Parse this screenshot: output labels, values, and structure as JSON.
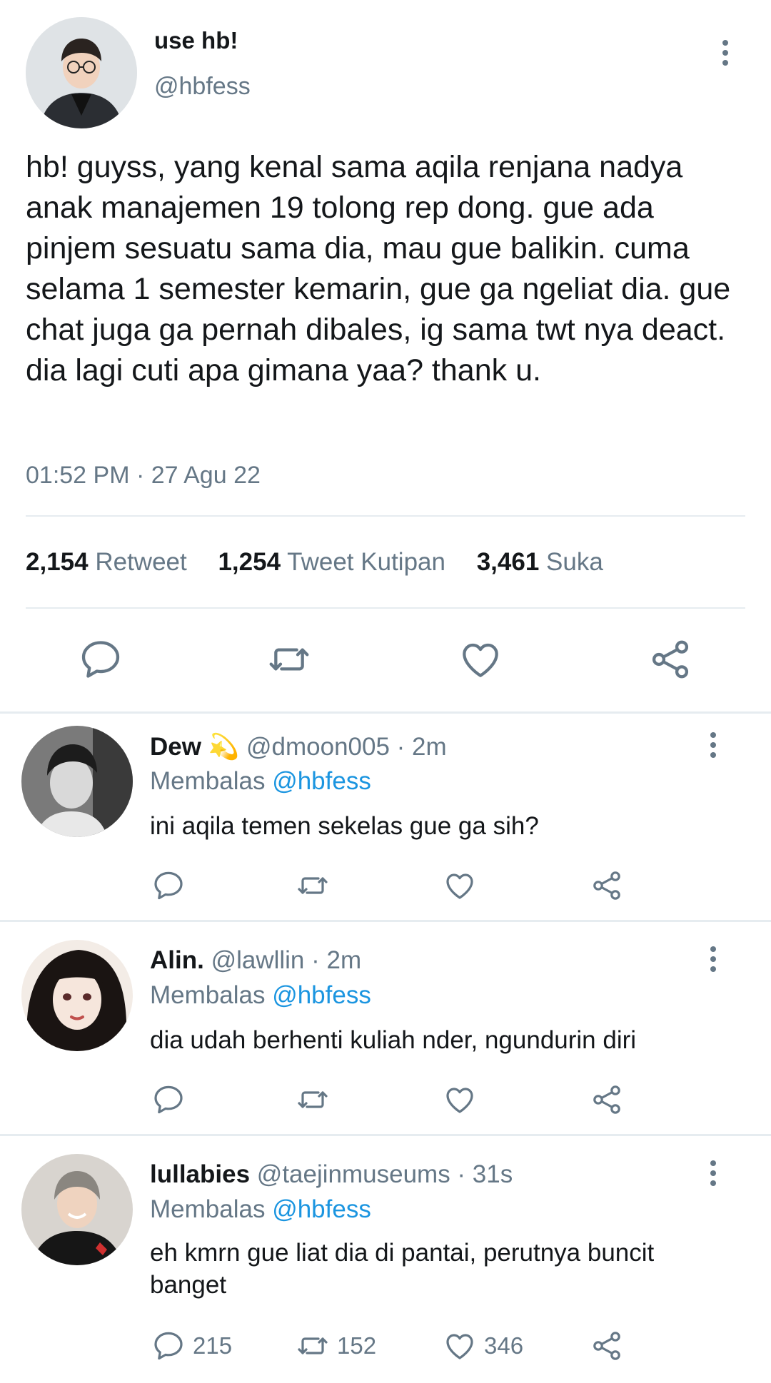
{
  "main_tweet": {
    "display_name": "use hb!",
    "handle": "@hbfess",
    "text": "hb! guyss, yang kenal sama aqila renjana nadya anak manajemen 19 tolong rep dong. gue ada pinjem sesuatu sama dia, mau gue balikin. cuma selama 1 semester kemarin, gue ga ngeliat dia. gue chat juga ga pernah dibales, ig sama twt nya deact. dia lagi cuti apa gimana yaa? thank u.",
    "timestamp": "01:52 PM · 27 Agu 22",
    "stats": {
      "retweets": "2,154",
      "retweets_label": "Retweet",
      "quotes": "1,254",
      "quotes_label": "Tweet Kutipan",
      "likes": "3,461",
      "likes_label": "Suka"
    }
  },
  "replies": [
    {
      "name": "Dew 💫",
      "meta": "@dmoon005 · 2m",
      "replying_prefix": "Membalas",
      "replying_to": "@hbfess",
      "text": "ini aqila temen sekelas gue ga sih?",
      "reply_count": "",
      "retweet_count": "",
      "like_count": ""
    },
    {
      "name": "Alin.",
      "meta": "@lawllin · 2m",
      "replying_prefix": "Membalas",
      "replying_to": "@hbfess",
      "text": "dia udah berhenti kuliah nder, ngundurin diri",
      "reply_count": "",
      "retweet_count": "",
      "like_count": ""
    },
    {
      "name": "lullabies",
      "meta": "@taejinmuseums · 31s",
      "replying_prefix": "Membalas",
      "replying_to": "@hbfess",
      "text": "eh kmrn gue liat dia di pantai, perutnya buncit banget",
      "reply_count": "215",
      "retweet_count": "152",
      "like_count": "346"
    }
  ],
  "colors": {
    "text": "#14171a",
    "secondary": "#657786",
    "link": "#1b95e0",
    "divider": "#e6ecf0"
  },
  "icons": [
    "more-vertical-icon",
    "reply-icon",
    "retweet-icon",
    "like-icon",
    "share-icon"
  ]
}
